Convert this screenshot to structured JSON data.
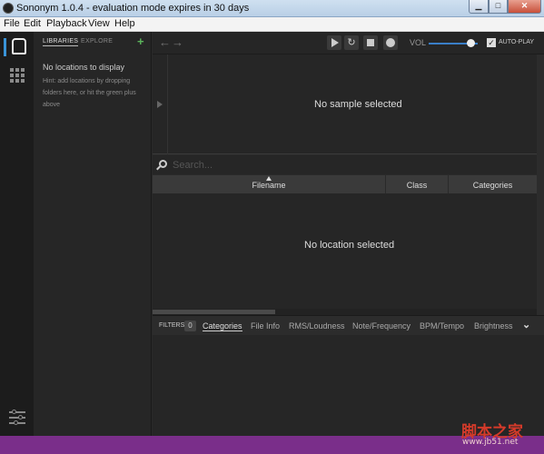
{
  "window": {
    "title": "Sononym 1.0.4 - evaluation mode expires in 30 days",
    "min_icon": "▁",
    "max_icon": "□",
    "close_icon": "✕"
  },
  "menu": [
    "File",
    "Edit",
    "Playback",
    "View",
    "Help"
  ],
  "libraries": {
    "tab_libraries": "LIBRARIES",
    "tab_explore": "EXPLORE",
    "add_icon": "+",
    "empty_title": "No locations to display",
    "hint": "Hint: add locations by dropping folders here, or hit the green plus above"
  },
  "toolbar": {
    "back_icon": "←",
    "forward_icon": "→",
    "loop_icon": "↻",
    "volume_label": "VOL",
    "volume_level": 0.85,
    "autoplay_label": "AUTO-PLAY",
    "autoplay_checked": true,
    "check_icon": "✓"
  },
  "sample": {
    "empty": "No sample selected"
  },
  "search": {
    "placeholder": "Search..."
  },
  "table": {
    "columns": [
      "Filename",
      "Class",
      "Categories"
    ],
    "empty": "No location selected"
  },
  "filters": {
    "label": "FILTERS",
    "count": "0",
    "tabs": [
      "Categories",
      "File Info",
      "RMS/Loudness",
      "Note/Frequency",
      "BPM/Tempo",
      "Brightness"
    ],
    "more_icon": "⌄"
  },
  "watermark": {
    "text": "脚本之家",
    "url": "www.jb51.net"
  },
  "colors": {
    "accent": "#3a94d8",
    "add_green": "#5bb35b",
    "taskbar": "#7a2e8a"
  }
}
